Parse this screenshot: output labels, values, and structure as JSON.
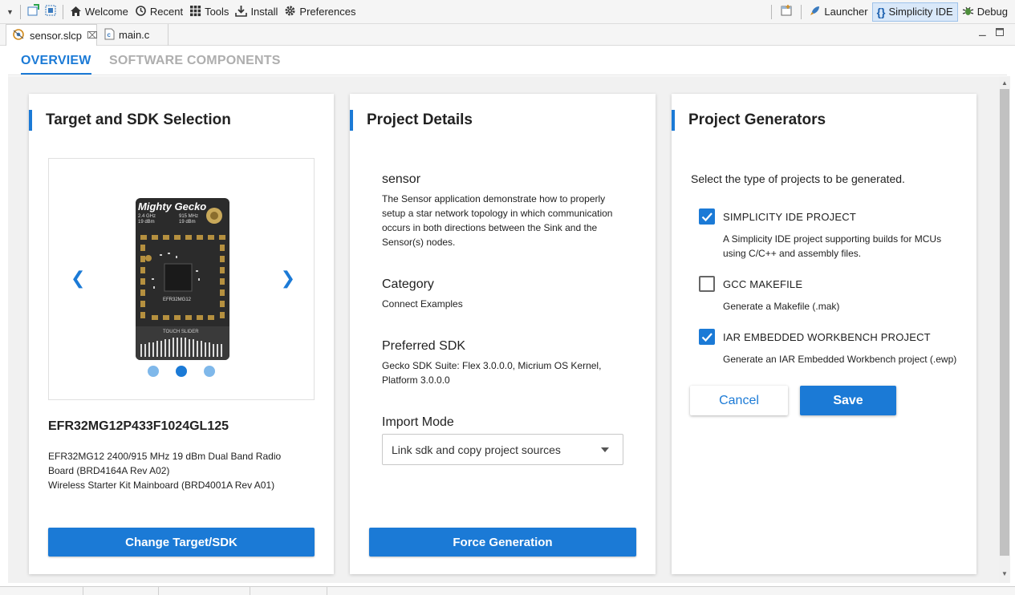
{
  "toolbar": {
    "items": [
      {
        "label": "Welcome",
        "icon": "home-icon"
      },
      {
        "label": "Recent",
        "icon": "history-icon"
      },
      {
        "label": "Tools",
        "icon": "grid-icon"
      },
      {
        "label": "Install",
        "icon": "download-icon"
      },
      {
        "label": "Preferences",
        "icon": "gear-icon"
      }
    ],
    "perspectives": [
      {
        "label": "Launcher",
        "icon": "rocket-icon",
        "active": false
      },
      {
        "label": "Simplicity IDE",
        "icon": "braces-icon",
        "active": true
      },
      {
        "label": "Debug",
        "icon": "bug-icon",
        "active": false
      }
    ]
  },
  "editor_tabs": [
    {
      "label": "sensor.slcp",
      "active": true,
      "closable": true
    },
    {
      "label": "main.c",
      "active": false,
      "closable": false
    }
  ],
  "page_tabs": {
    "overview": "OVERVIEW",
    "software_components": "SOFTWARE COMPONENTS"
  },
  "target_card": {
    "title": "Target and SDK Selection",
    "board_label": "Mighty Gecko",
    "board_chip": "EFR32MG12",
    "board_slider": "TOUCH SLIDER",
    "board_specs_left": "2.4 GHz\n19 dBm",
    "board_specs_right": "915 MHz\n19 dBm",
    "carousel_active_index": 2,
    "part_name": "EFR32MG12P433F1024GL125",
    "part_desc_line1": "EFR32MG12 2400/915 MHz 19 dBm Dual Band Radio",
    "part_desc_line2": "Board (BRD4164A Rev A02)",
    "part_desc_line3": "Wireless Starter Kit Mainboard (BRD4001A Rev A01)",
    "button": "Change Target/SDK"
  },
  "details_card": {
    "title": "Project Details",
    "project_name": "sensor",
    "project_desc": "The Sensor application demonstrate how to properly setup a star network topology in which communication occurs in both directions between the Sink and the Sensor(s) nodes.",
    "category_label": "Category",
    "category_value": "Connect Examples",
    "sdk_label": "Preferred SDK",
    "sdk_value": "Gecko SDK Suite: Flex 3.0.0.0, Micrium OS Kernel, Platform 3.0.0.0",
    "import_label": "Import Mode",
    "import_value": "Link sdk and copy project sources",
    "button": "Force Generation"
  },
  "generators_card": {
    "title": "Project Generators",
    "intro": "Select the type of projects to be generated.",
    "options": [
      {
        "label": "SIMPLICITY IDE PROJECT",
        "desc": "A Simplicity IDE project supporting builds for MCUs using C/C++ and assembly files.",
        "checked": true
      },
      {
        "label": "GCC MAKEFILE",
        "desc": "Generate a Makefile (.mak)",
        "checked": false
      },
      {
        "label": "IAR EMBEDDED WORKBENCH PROJECT",
        "desc": "Generate an IAR Embedded Workbench project (.ewp)",
        "checked": true
      }
    ],
    "cancel": "Cancel",
    "save": "Save"
  },
  "colors": {
    "accent": "#1b7ad6",
    "inactive_tab": "#aeaeae",
    "content_bg": "#f1f1f1"
  }
}
